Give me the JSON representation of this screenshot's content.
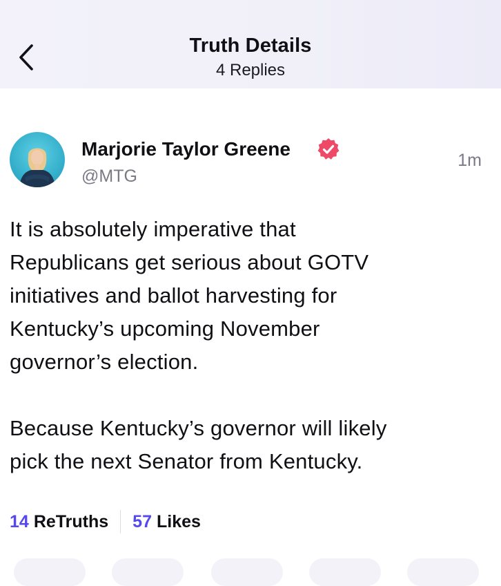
{
  "header": {
    "title": "Truth Details",
    "replies": "4 Replies",
    "back_icon": "chevron-left-icon"
  },
  "post": {
    "author": {
      "name": "Marjorie Taylor Greene",
      "handle": "@MTG",
      "verified": true,
      "verified_icon": "verified-badge-icon",
      "verified_color": "#ee4a68"
    },
    "timestamp": "1m",
    "paragraphs": [
      "It is absolutely imperative that\nRepublicans get serious about GOTV\ninitiatives and ballot harvesting for\nKentucky’s upcoming November\ngovernor’s election.",
      "Because Kentucky’s governor will likely\npick the next Senator from Kentucky."
    ],
    "stats": {
      "retruths_count": "14",
      "retruths_label": "ReTruths",
      "likes_count": "57",
      "likes_label": "Likes"
    }
  },
  "colors": {
    "accent": "#5448ee",
    "header_bg": "#f2f1f9",
    "muted_text": "#7a7a86"
  }
}
